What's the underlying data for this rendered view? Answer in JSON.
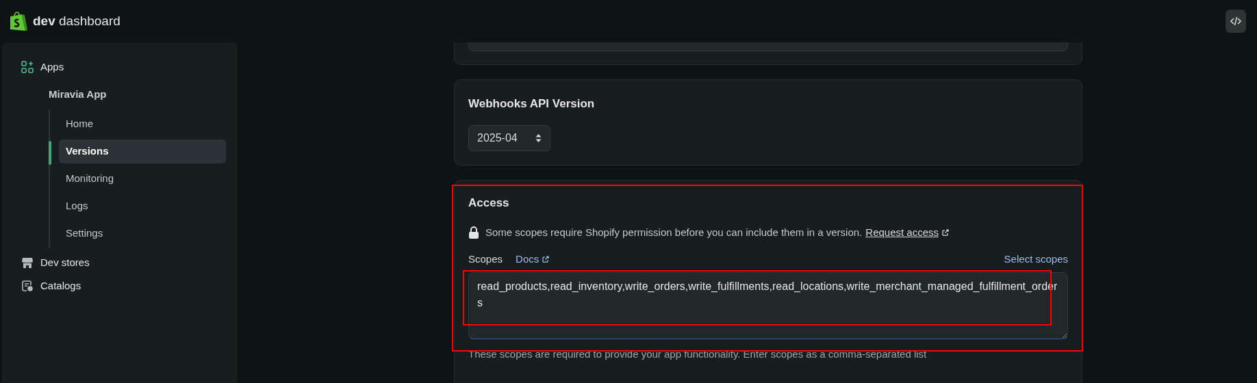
{
  "header": {
    "brand": "**dev** dashboard"
  },
  "sidebar": {
    "items": [
      {
        "label": "Apps",
        "kind": "apps",
        "children": [
          {
            "label": "Miravia App",
            "children": [
              {
                "label": "Home",
                "selected": false
              },
              {
                "label": "Versions",
                "selected": true
              },
              {
                "label": "Monitoring",
                "selected": false
              },
              {
                "label": "Logs",
                "selected": false
              },
              {
                "label": "Settings",
                "selected": false
              }
            ]
          }
        ]
      },
      {
        "label": "Dev stores",
        "kind": "store"
      },
      {
        "label": "Catalogs",
        "kind": "catalog"
      }
    ]
  },
  "webhooks": {
    "title": "Webhooks API Version",
    "select": {
      "value": "2025-04"
    }
  },
  "access": {
    "title": "Access",
    "notice": "Some scopes require Shopify permission before you can include them in a version.",
    "notice_link": "Request access",
    "scopes_label": "Scopes",
    "docs_link": "Docs",
    "select_scopes": "Select scopes",
    "scopes_value": "read_products,read_inventory,write_orders,write_fulfillments,read_locations,write_merchant_managed_fulfillment_orders",
    "helper": "These scopes are required to provide your app functionality. Enter scopes as a comma-separated list"
  }
}
